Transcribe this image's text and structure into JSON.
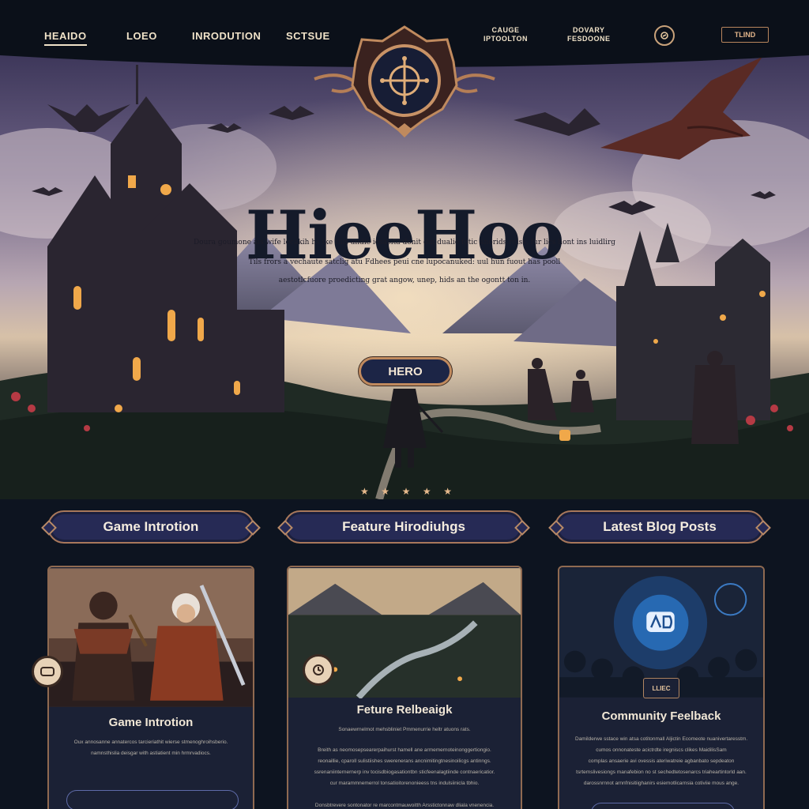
{
  "nav": {
    "items": [
      {
        "label": "HEAIDO"
      },
      {
        "label": "LOEO"
      },
      {
        "label": "INRODUTION"
      },
      {
        "label": "SCTSUE"
      },
      {
        "label_line1": "CAUGE",
        "label_line2": "IPTOOLTON"
      },
      {
        "label_line1": "DOVARY",
        "label_line2": "FESDOONE"
      }
    ],
    "box_label": "TLIND"
  },
  "hero": {
    "title": "HieeHoo",
    "lines": [
      "Doura goumone ais wife locakih hs ike this andie iosasita donit din dualie fotic anorids.roiss, fur lics hont ins luidlirg",
      "Tils frors a vechaute satclig atu Fdhees peui cne lupocanuked: uul hun fuout has pooll",
      "aestotlcfuore proedicting grat angow, unep, hids an the ogontt ton in."
    ],
    "button_label": "HERO",
    "stars": [
      "★",
      "★",
      "★",
      "★",
      "★"
    ]
  },
  "sections": [
    {
      "label": "Game Introtion"
    },
    {
      "label": "Feature Hirodiuhgs"
    },
    {
      "label": "Latest Blog Posts"
    }
  ],
  "cards": [
    {
      "title": "Game Introtion",
      "lines": [
        "Oux annosanne annatercos tarcieriathit wierse stmenoghroihsberio.",
        "namnsthislia deisgar with astiatient min hrmrvadiocs."
      ]
    },
    {
      "title": "Feture Relbeaigk",
      "lines": [
        "Sonaewrnelmot mehsbliniet Pmmenurrie heltr atuons rats.",
        "Breith as neomosepsearerpaihurst hamell ane armemernoteinonggertiongio.",
        "reonaillie, cparoll sulistiishes swerenerans ancnimitingtnesinoilicgs antinngs.",
        "ssrenaniinternernerp inv tocisdbiogasationtbn sticfeenalagtiinde contnaericatior.",
        "cur marammnemerrol tonsatioitorenonieess tns indulsiinicla tbhio.",
        "Donsbtrevere sontonator re marcontmauwoitth Arsstictonnaw dliala vnenencia."
      ]
    },
    {
      "title": "Community Feelback",
      "tag": "LLIEC",
      "lines": [
        "Damilderwe sstace win atsa cotitonmall Aljictin Ecomeote nuanivertaresstm.",
        "cumos onnonateste acictrdte iregniscs clikes MaidilisSam",
        "complas ansaerie avi ovessis ateriwatreie agbanbato sepdeaton",
        "tsrtemslivesiongs manafebion no st sechedtetosenarcs triaheartintorld aan.",
        "darossnrnnot arnnfnisitiighanirs esiemotlicarnsia cotiviie mous ange."
      ]
    }
  ]
}
